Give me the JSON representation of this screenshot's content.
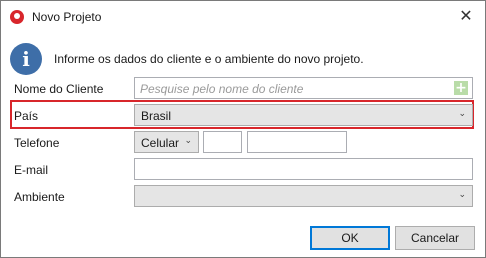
{
  "window": {
    "title": "Novo Projeto",
    "close_glyph": "✕"
  },
  "info": {
    "icon": "info-icon",
    "glyph": "i",
    "text": "Informe os dados do cliente e o ambiente do novo projeto."
  },
  "form": {
    "cliente": {
      "label": "Nome do Cliente",
      "placeholder": "Pesquise pelo nome do cliente",
      "add_glyph": "+"
    },
    "pais": {
      "label": "País",
      "value": "Brasil"
    },
    "telefone": {
      "label": "Telefone",
      "type_value": "Celular",
      "ddd": "",
      "numero": ""
    },
    "email": {
      "label": "E-mail",
      "value": ""
    },
    "ambiente": {
      "label": "Ambiente",
      "value": ""
    }
  },
  "buttons": {
    "ok": "OK",
    "cancel": "Cancelar"
  },
  "colors": {
    "highlight": "#d8262b",
    "accent": "#0078d7",
    "info_icon": "#3e6ea8"
  }
}
